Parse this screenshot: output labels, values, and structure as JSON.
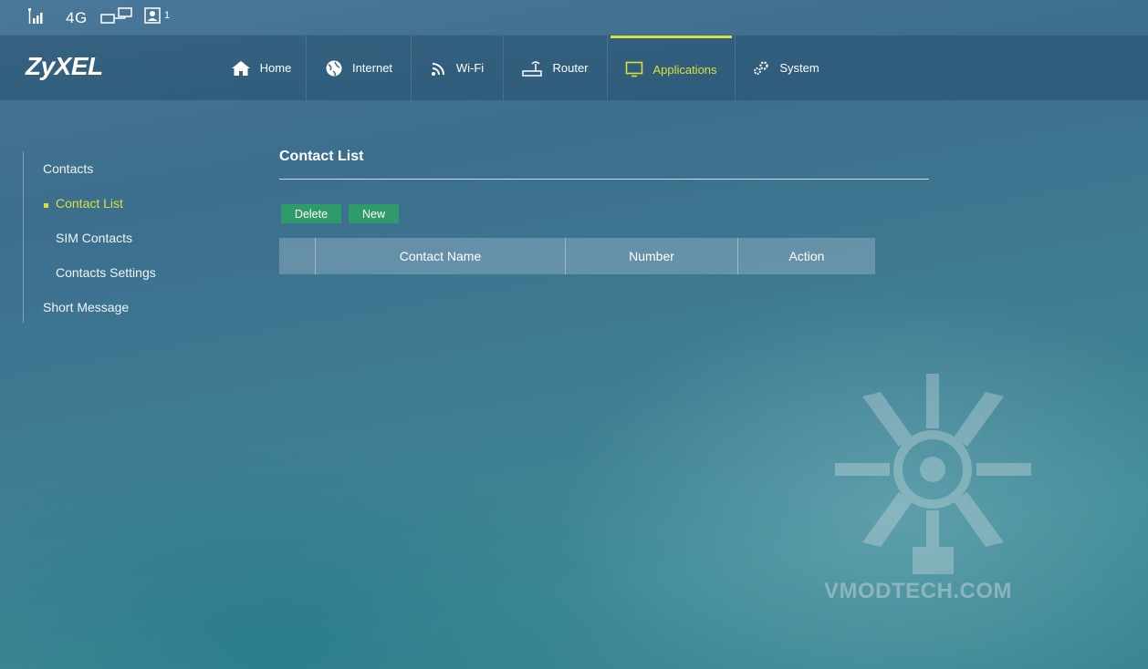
{
  "statusbar": {
    "signal_icon": "signal-bars-icon",
    "network_type": "4G",
    "network_icon": "network-icon",
    "sim_icon": "sim-contact-icon",
    "sim_count": "1"
  },
  "header": {
    "logo": "ZyXEL",
    "nav": [
      {
        "label": "Home",
        "icon": "home-icon"
      },
      {
        "label": "Internet",
        "icon": "globe-icon"
      },
      {
        "label": "Wi-Fi",
        "icon": "wifi-icon"
      },
      {
        "label": "Router",
        "icon": "router-icon"
      },
      {
        "label": "Applications",
        "icon": "monitor-icon",
        "active": true
      },
      {
        "label": "System",
        "icon": "gear-icon"
      }
    ]
  },
  "sidebar": {
    "items": [
      {
        "label": "Contacts"
      },
      {
        "label": "Contact List",
        "active": true
      },
      {
        "label": "SIM Contacts"
      },
      {
        "label": "Contacts Settings"
      },
      {
        "label": "Short Message"
      }
    ]
  },
  "main": {
    "title": "Contact List",
    "buttons": {
      "delete": "Delete",
      "new": "New"
    },
    "table": {
      "columns": [
        "",
        "Contact Name",
        "Number",
        "Action"
      ],
      "rows": []
    }
  },
  "watermark": {
    "text": "VMODTECH.COM"
  },
  "colors": {
    "accent": "#d6e23a",
    "button": "#2f9a6a"
  }
}
